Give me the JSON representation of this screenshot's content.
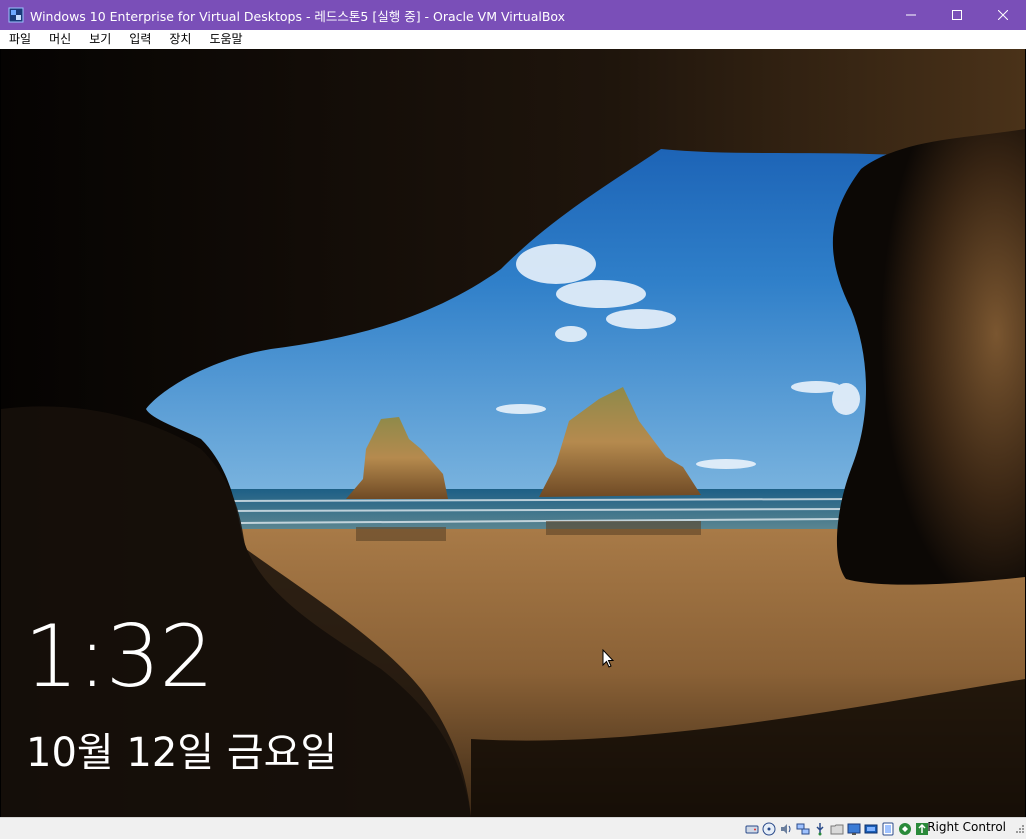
{
  "window": {
    "title": "Windows 10 Enterprise for Virtual Desktops - 레드스톤5 [실행 중] - Oracle VM VirtualBox",
    "controls": [
      "minimize",
      "maximize",
      "close"
    ]
  },
  "menubar": {
    "items": [
      "파일",
      "머신",
      "보기",
      "입력",
      "장치",
      "도움말"
    ]
  },
  "lockscreen": {
    "time": "1:32",
    "date": "10월 12일 금요일"
  },
  "statusbar": {
    "icons": [
      "hard-disk-icon",
      "optical-drive-icon",
      "audio-icon",
      "network-icon",
      "usb-icon",
      "shared-folders-icon",
      "display-icon",
      "video-capture-icon",
      "virtualization-icon",
      "mouse-integration-icon",
      "keyboard-icon"
    ],
    "host_key": "Right Control"
  },
  "colors": {
    "titlebar": "#7a4fb8",
    "menubar": "#ffffff",
    "statusbar": "#f0f0f0"
  }
}
